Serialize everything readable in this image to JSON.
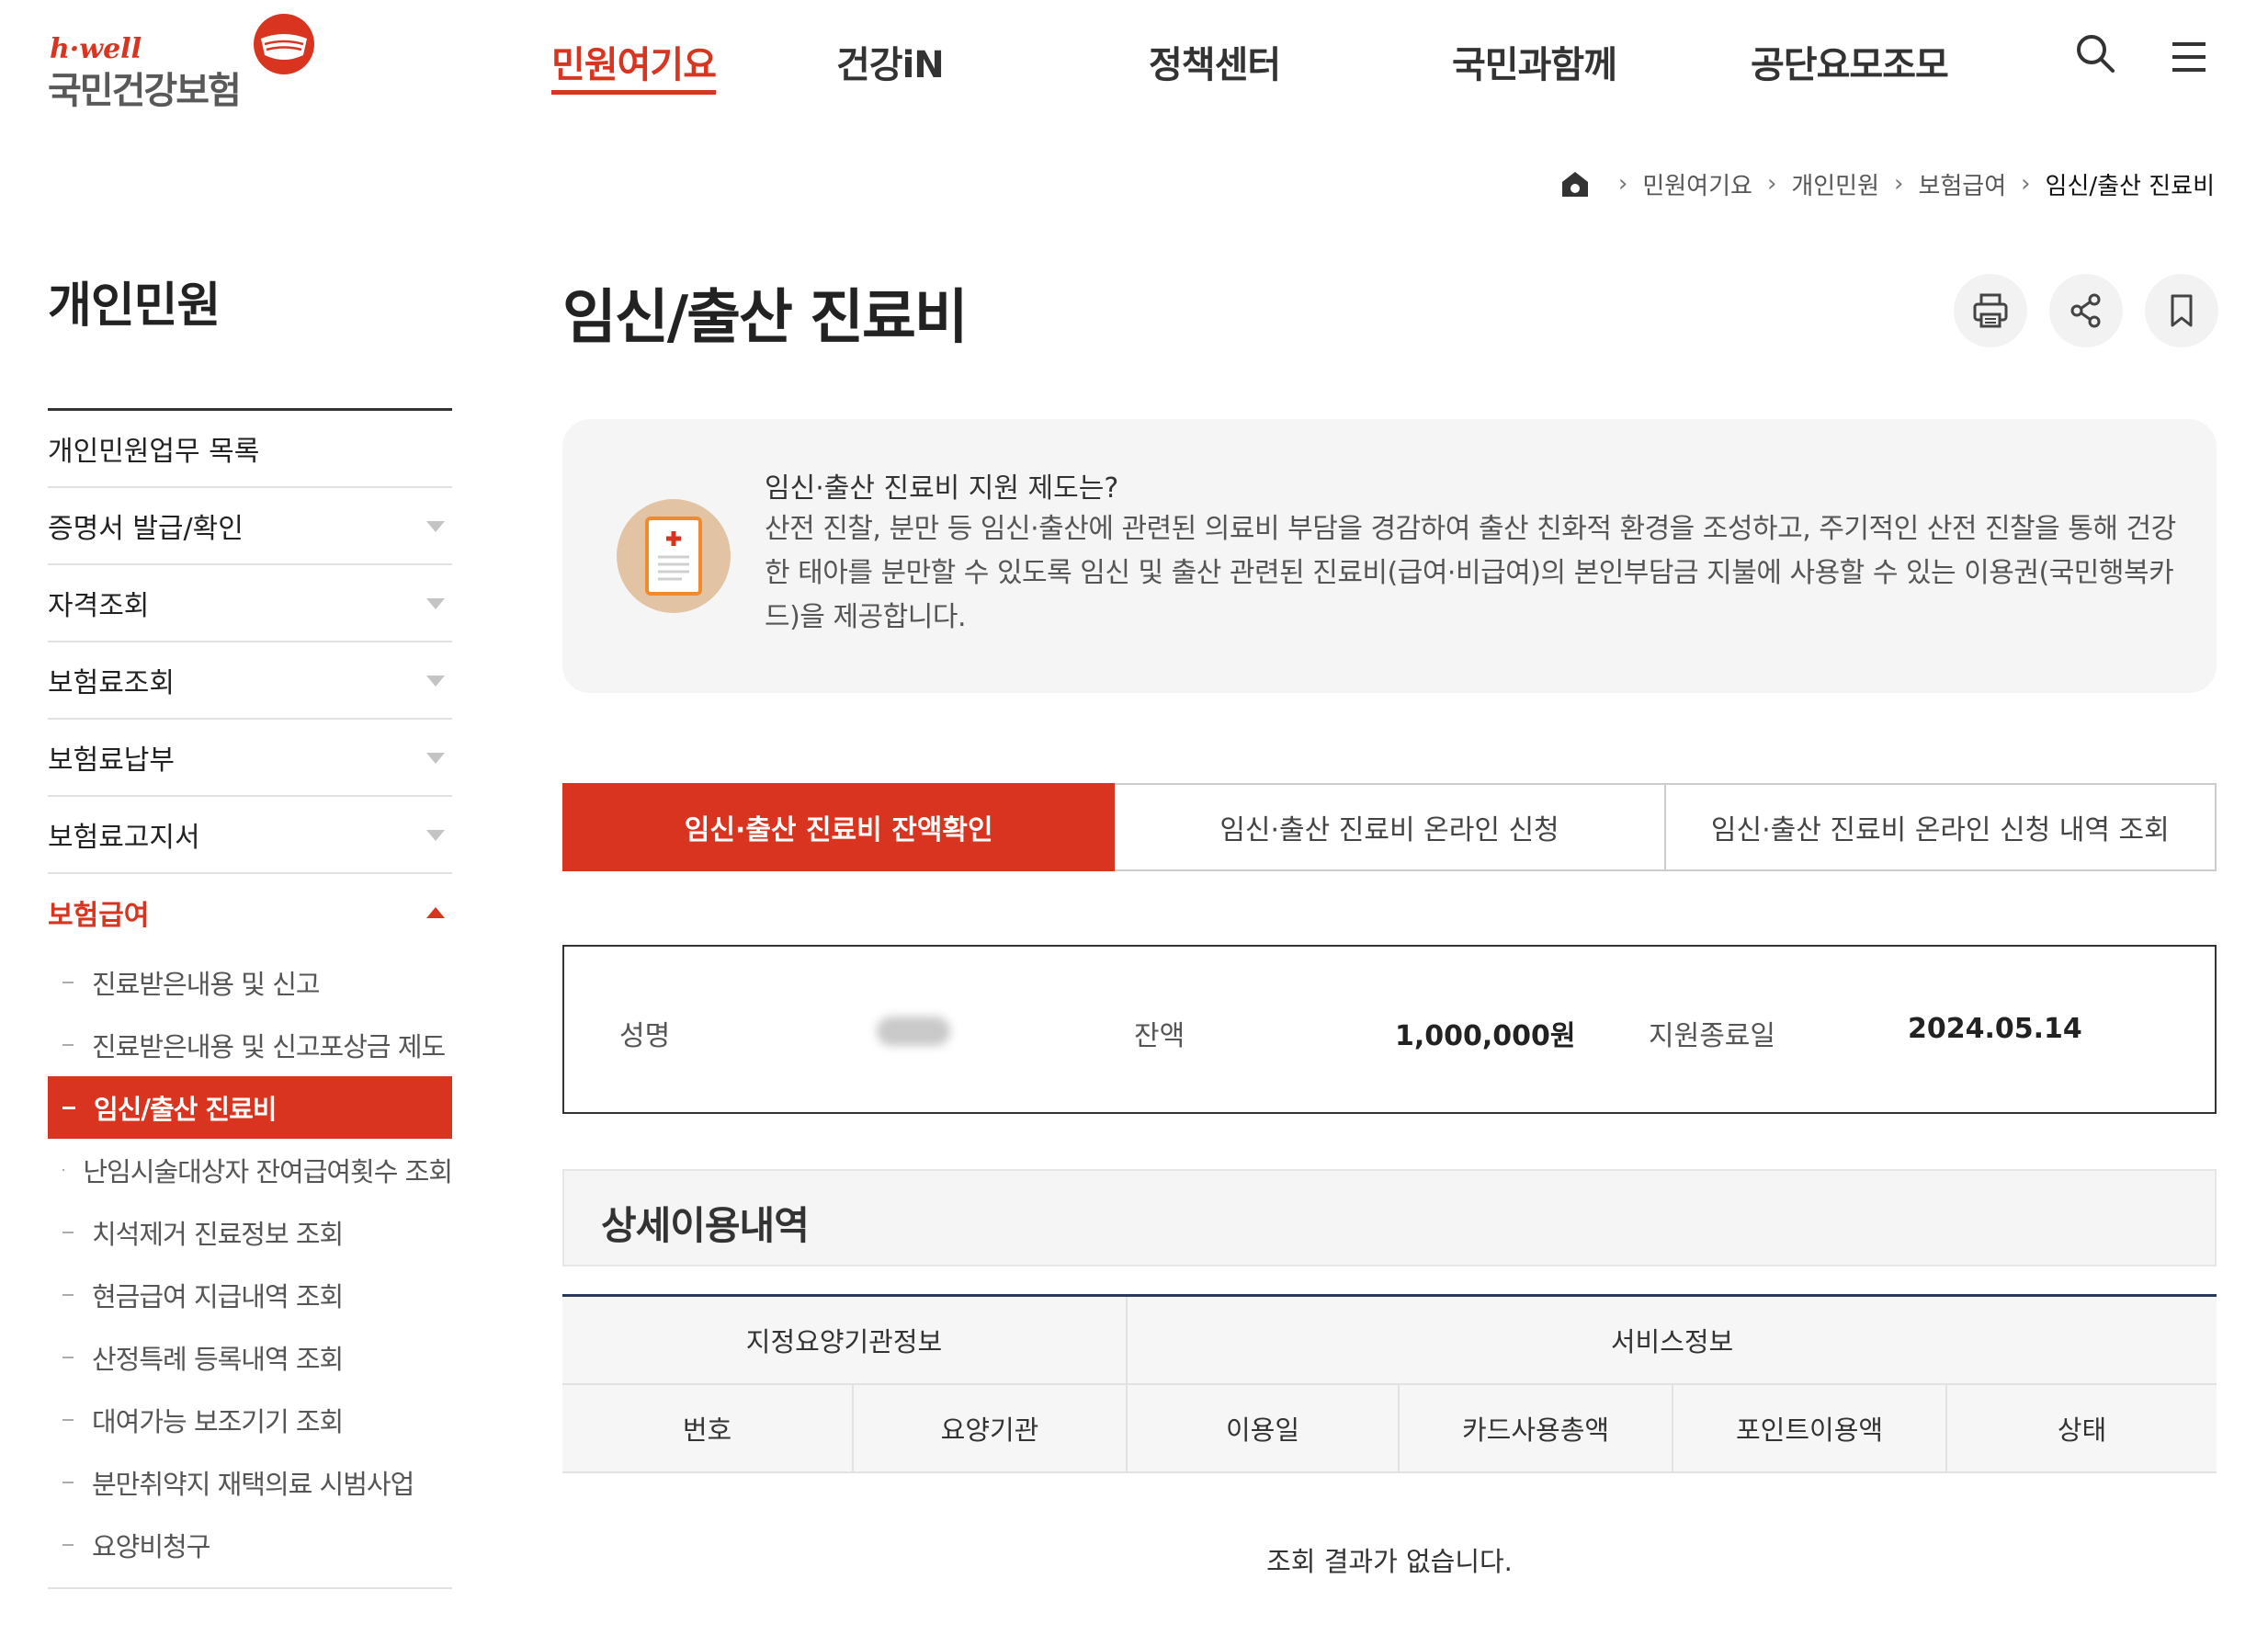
{
  "header": {
    "logo_top": "h·well",
    "logo_name": "국민건강보험",
    "nav": [
      "민원여기요",
      "건강iN",
      "정책센터",
      "국민과함께",
      "공단요모조모"
    ],
    "active_nav": 0
  },
  "breadcrumb": [
    "민원여기요",
    "개인민원",
    "보험급여",
    "임신/출산 진료비"
  ],
  "sidebar": {
    "title": "개인민원",
    "items": [
      {
        "label": "개인민원업무 목록"
      },
      {
        "label": "증명서 발급/확인"
      },
      {
        "label": "자격조회"
      },
      {
        "label": "보험료조회"
      },
      {
        "label": "보험료납부"
      },
      {
        "label": "보험료고지서"
      },
      {
        "label": "보험급여"
      }
    ],
    "sub_items": [
      "진료받은내용 및 신고",
      "진료받은내용 및 신고포상금 제도",
      "임신/출산 진료비",
      "난임시술대상자 잔여급여횟수 조회",
      "치석제거 진료정보 조회",
      "현금급여 지급내역 조회",
      "산정특례 등록내역 조회",
      "대여가능 보조기기 조회",
      "분만취약지 재택의료 시범사업",
      "요양비청구"
    ],
    "active_sub": 2
  },
  "page": {
    "title": "임신/출산 진료비"
  },
  "intro": {
    "heading": "임신·출산 진료비 지원 제도는?",
    "body": "산전 진찰, 분만 등 임신·출산에 관련된 의료비 부담을 경감하여 출산 친화적 환경을 조성하고, 주기적인 산전 진찰을 통해 건강한 태아를 분만할 수 있도록 임신 및 출산 관련된 진료비(급여·비급여)의 본인부담금 지불에 사용할 수 있는 이용권(국민행복카드)을 제공합니다."
  },
  "tabs": [
    "임신·출산 진료비 잔액확인",
    "임신·출산 진료비 온라인 신청",
    "임신·출산 진료비 온라인 신청 내역 조회"
  ],
  "summary": {
    "name_label": "성명",
    "balance_label": "잔액",
    "balance_value": "1,000,000원",
    "end_date_label": "지원종료일",
    "end_date_value": "2024.05.14"
  },
  "detail": {
    "section_title": "상세이용내역",
    "group_headers": [
      "지정요양기관정보",
      "서비스정보"
    ],
    "columns": [
      "번호",
      "요양기관",
      "이용일",
      "카드사용총액",
      "포인트이용액",
      "상태"
    ],
    "empty_message": "조회 결과가 없습니다."
  },
  "colors": {
    "accent": "#d8341f",
    "table_top_border": "#2b3a5a"
  },
  "icons": {
    "search": "search-icon",
    "menu": "hamburger-menu-icon",
    "home": "home-icon",
    "print": "print-icon",
    "share": "share-icon",
    "bookmark": "bookmark-icon"
  }
}
